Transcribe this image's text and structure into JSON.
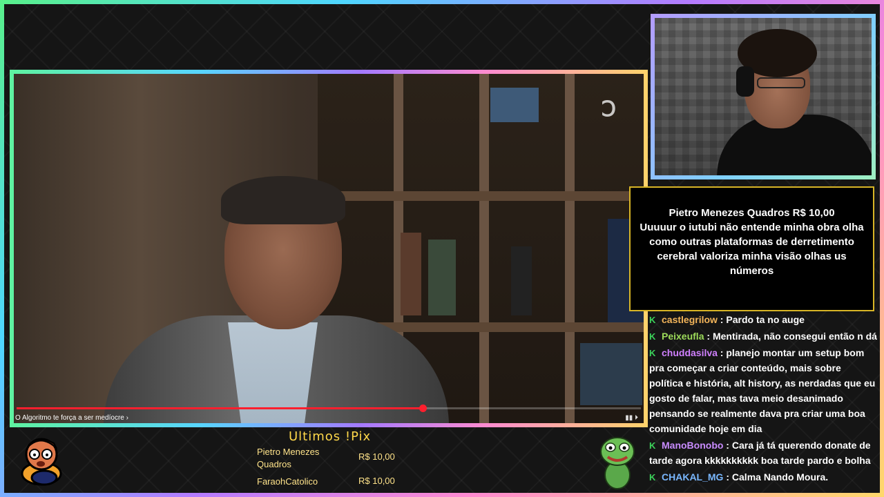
{
  "donation": {
    "header": "Pietro Menezes Quadros R$ 10,00",
    "message": "Uuuuur o iutubi não entende minha obra olha como outras plataformas de derretimento cerebral valoriza minha visão olhas us números"
  },
  "chat": {
    "messages": [
      {
        "user": "castlegrilow",
        "color": "#f3b55a",
        "text": "Pardo ta no auge"
      },
      {
        "user": "Peixeufla",
        "color": "#9cdb5a",
        "text": "Mentirada, não consegui então n dá"
      },
      {
        "user": "chuddasilva",
        "color": "#d080ff",
        "text": "planejo montar um setup bom pra começar a criar conteúdo, mais sobre política e história, alt history, as nerdadas que eu gosto de falar, mas tava meio desanimado pensando se realmente dava pra criar uma boa comunidade hoje em dia"
      },
      {
        "user": "ManoBonobo",
        "color": "#c98cff",
        "text": "Cara já tá querendo donate de tarde agora kkkkkkkkkk boa tarde pardo e bolha"
      },
      {
        "user": "CHAKAL_MG",
        "color": "#7ab8ff",
        "text": "Calma Nando Moura."
      }
    ]
  },
  "video": {
    "caption": "O Algoritmo te força a ser medíocre ›",
    "progress": 0.65
  },
  "pix": {
    "title": "Ultimos !Pix",
    "entries": [
      {
        "name": "Pietro Menezes Quadros",
        "amount": "R$ 10,00"
      },
      {
        "name": "FaraohCatolico",
        "amount": "R$ 10,00"
      }
    ]
  },
  "icons": {
    "chat_badge": "kick-k-icon"
  },
  "colors": {
    "accent_gold": "#d8b526",
    "progress_red": "#ff1f2e",
    "kick_green": "#3bd35a"
  }
}
